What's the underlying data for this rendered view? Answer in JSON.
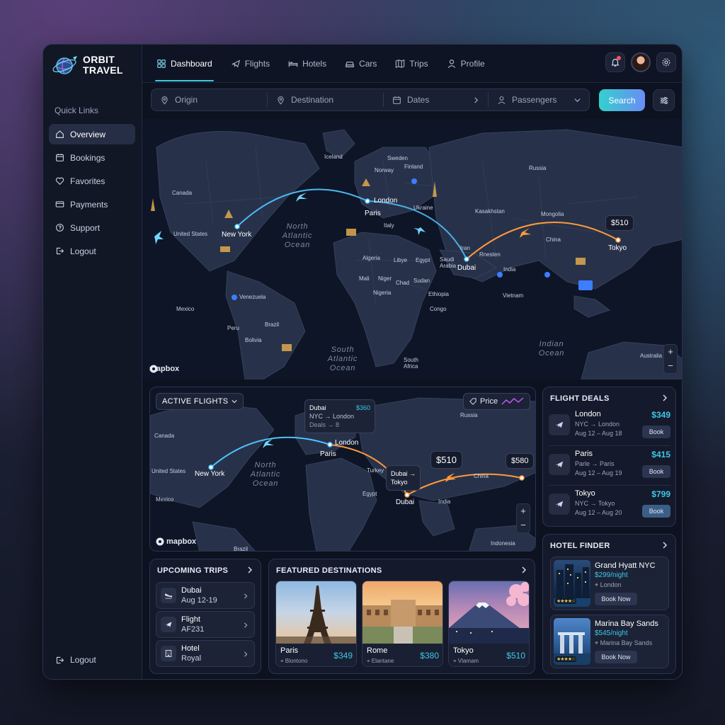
{
  "brand": {
    "line1": "ORBIT",
    "line2": "TRAVEL"
  },
  "sidebar": {
    "section_title": "Quick Links",
    "items": [
      {
        "label": "Overview",
        "icon": "home-icon",
        "active": true
      },
      {
        "label": "Bookings",
        "icon": "calendar-icon"
      },
      {
        "label": "Favorites",
        "icon": "heart-icon"
      },
      {
        "label": "Payments",
        "icon": "card-icon"
      },
      {
        "label": "Support",
        "icon": "help-icon"
      },
      {
        "label": "Logout",
        "icon": "logout-icon"
      }
    ],
    "bottom_logout": "Logout"
  },
  "tabs": [
    {
      "label": "Dashboard",
      "icon": "grid-icon",
      "active": true
    },
    {
      "label": "Flights",
      "icon": "plane-icon"
    },
    {
      "label": "Hotels",
      "icon": "bed-icon"
    },
    {
      "label": "Cars",
      "icon": "car-icon"
    },
    {
      "label": "Trips",
      "icon": "map-icon"
    },
    {
      "label": "Profile",
      "icon": "user-icon"
    }
  ],
  "search": {
    "origin_placeholder": "Origin",
    "destination_placeholder": "Destination",
    "dates_placeholder": "Dates",
    "passengers_placeholder": "Passengers",
    "button": "Search"
  },
  "main_map": {
    "attribution": "mapbox",
    "countries": [
      "Iceland",
      "Sweden",
      "Finland",
      "Norway",
      "Russia",
      "Canada",
      "United States",
      "Ukraine",
      "Kasakhstan",
      "Mongolia",
      "Italy",
      "China",
      "Mexico",
      "Algeria",
      "Libye",
      "Egypt",
      "Iran",
      "Rnesten",
      "Saudi Arabia",
      "India",
      "Mali",
      "Niger",
      "Chad",
      "Sudan",
      "Ethiopia",
      "Nigeria",
      "Venezuela",
      "Peru",
      "Brazil",
      "Bolivia",
      "Congo",
      "South Africa",
      "Vietnam",
      "Australia"
    ],
    "oceans": [
      "North Atlantic Ocean",
      "South Atlantic Ocean",
      "Indian Ocean"
    ],
    "cities": [
      "New York",
      "London",
      "Paris",
      "Dubai",
      "Tokyo"
    ],
    "price_label": "$510"
  },
  "active_flights": {
    "dropdown": "ACTIVE FLIGHTS",
    "price_toggle": "Price",
    "tooltip1": {
      "title": "Dubai",
      "price": "$360",
      "route": "NYC → London",
      "meta": "Deals → 8"
    },
    "tooltip2": {
      "line1": "Dubai →",
      "line2": "Tokyo"
    },
    "price_main": "$510",
    "price_right": "$580",
    "countries": [
      "Canada",
      "United States",
      "Russia",
      "Mexico",
      "China",
      "India",
      "Indonesia",
      "Brazil",
      "Turkey",
      "Egypt"
    ],
    "ocean": "North Atlantic Ocean",
    "cities": [
      "New York",
      "London",
      "Paris",
      "Dubai"
    ],
    "attribution": "mapbox"
  },
  "flight_deals": {
    "title": "FLIGHT DEALS",
    "deals": [
      {
        "city": "London",
        "route": "NYC → London",
        "dates": "Aug 12 – Aug 18",
        "price": "$349",
        "book": "Book"
      },
      {
        "city": "Paris",
        "route": "Parle → Paris",
        "dates": "Aug 12 – Aug 19",
        "price": "$415",
        "book": "Book"
      },
      {
        "city": "Tokyo",
        "route": "NYC → Tokyo",
        "dates": "Aug 12 – Aug 20",
        "price": "$799",
        "book": "Book"
      }
    ]
  },
  "hotel_finder": {
    "title": "HOTEL FINDER",
    "hotels": [
      {
        "name": "Grand Hyatt NYC",
        "price": "$299/night",
        "location": "London",
        "book": "Book Now",
        "rating": "★★★★☆"
      },
      {
        "name": "Marina Bay Sands",
        "price": "$545/night",
        "location": "Marina Bay Sands",
        "book": "Book Now",
        "rating": "★★★★☆"
      }
    ]
  },
  "upcoming_trips": {
    "title": "UPCOMING TRIPS",
    "items": [
      {
        "line1": "Dubai",
        "line2": "Aug 12-19",
        "icon": "plane-landing-icon"
      },
      {
        "line1": "Flight",
        "line2": "AF231",
        "icon": "plane-icon"
      },
      {
        "line1": "Hotel",
        "line2": "Royal",
        "icon": "building-icon"
      }
    ]
  },
  "featured": {
    "title": "FEATURED DESTINATIONS",
    "items": [
      {
        "name": "Paris",
        "sub": "Blontono",
        "price": "$349"
      },
      {
        "name": "Rome",
        "sub": "Elantane",
        "price": "$380"
      },
      {
        "name": "Tokyo",
        "sub": "Vlamam",
        "price": "$510"
      }
    ]
  },
  "colors": {
    "accent": "#3ec7e0",
    "route_blue": "#4fc3ff",
    "route_orange": "#ff9a3c",
    "price": "#3fc6e6"
  }
}
